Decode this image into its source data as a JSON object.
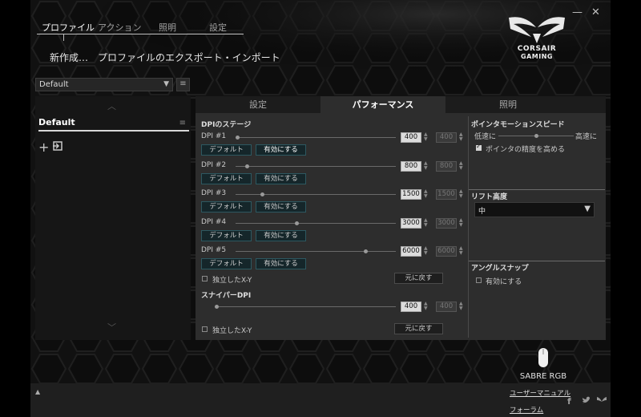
{
  "window": {
    "minimize": "—",
    "close": "✕"
  },
  "topnav": {
    "tabs": [
      "プロファイル",
      "アクション",
      "照明",
      "設定"
    ],
    "active": 0
  },
  "submenu": {
    "new": "新作成…",
    "export": "プロファイルのエクスポート・インポート"
  },
  "logo": {
    "line1": "CORSAIR",
    "line2": "GAMING"
  },
  "profile_select": {
    "value": "Default"
  },
  "profile_list": {
    "items": [
      {
        "name": "Default"
      }
    ]
  },
  "main_tabs": {
    "tabs": [
      "設定",
      "パフォーマンス",
      "照明"
    ],
    "active": 1
  },
  "dpi": {
    "header": "DPIのステージ",
    "stages": [
      {
        "label": "DPI #1",
        "value": "400",
        "y_value": "400",
        "default_label": "デフォルト",
        "enable_label": "有効にする",
        "level": 0.0,
        "enabled": true
      },
      {
        "label": "DPI #2",
        "value": "800",
        "y_value": "800",
        "default_label": "デフォルト",
        "enable_label": "有効にする",
        "level": 0.06,
        "enabled": false
      },
      {
        "label": "DPI #3",
        "value": "1500",
        "y_value": "1500",
        "default_label": "デフォルト",
        "enable_label": "有効にする",
        "level": 0.16,
        "enabled": false
      },
      {
        "label": "DPI #4",
        "value": "3000",
        "y_value": "3000",
        "default_label": "デフォルト",
        "enable_label": "有効にする",
        "level": 0.38,
        "enabled": false
      },
      {
        "label": "DPI #5",
        "value": "6000",
        "y_value": "6000",
        "default_label": "デフォルト",
        "enable_label": "有効にする",
        "level": 0.82,
        "enabled": false
      }
    ],
    "independent_xy": "独立したX-Y",
    "reset": "元に戻す"
  },
  "sniper": {
    "header": "スナイパーDPI",
    "value": "400",
    "y_value": "400",
    "level": 0.0,
    "independent_xy": "独立したX-Y",
    "reset": "元に戻す"
  },
  "pointer_speed": {
    "header": "ポインタモーションスピード",
    "low": "低速に",
    "high": "高速に",
    "level": 0.5,
    "precision_label": "ポインタの精度を高める",
    "precision_checked": true
  },
  "lift_height": {
    "header": "リフト高度",
    "value": "中"
  },
  "angle_snap": {
    "header": "アングルスナップ",
    "enable_label": "有効にする",
    "checked": false
  },
  "device": {
    "name": "SABRE RGB"
  },
  "footer": {
    "manual": "ユーザーマニュアル",
    "forum": "フォーラム",
    "up": "▲"
  },
  "icons": {
    "add": "plus-icon",
    "import": "import-icon",
    "social": [
      "facebook-icon",
      "twitter-icon",
      "corsair-icon"
    ]
  },
  "colors": {
    "panel": "#2d2d2d",
    "teal_button": "#15262a",
    "background": "#161616"
  }
}
